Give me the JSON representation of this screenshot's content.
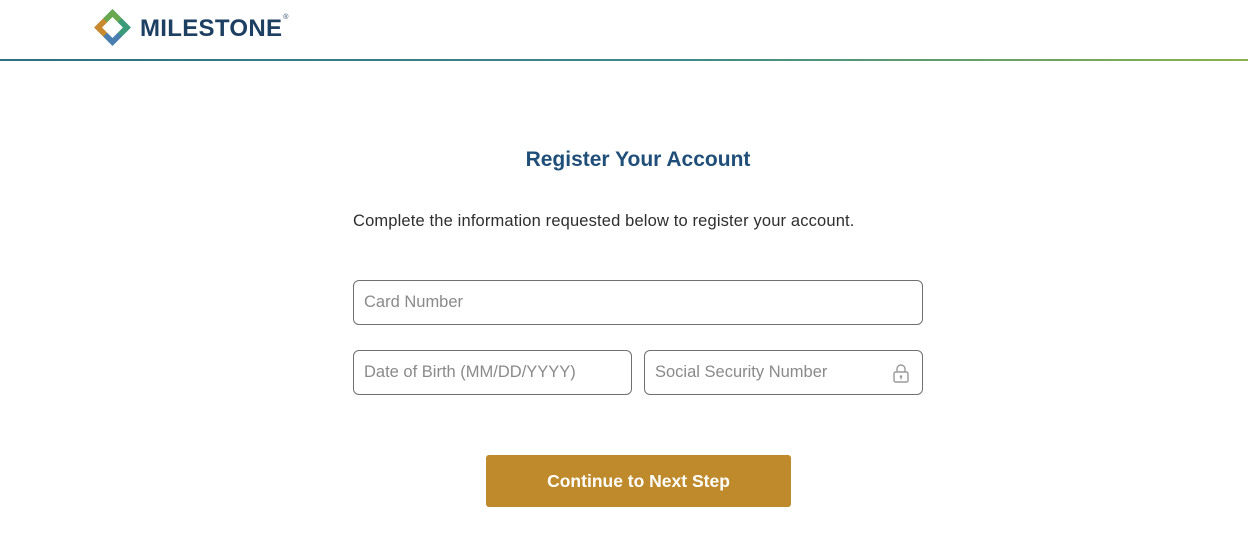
{
  "header": {
    "brand_name": "MILESTONE",
    "brand_mark": "®",
    "logo_icon": "milestone-diamond-logo",
    "accent_gradient": [
      "#2d6f83",
      "#3d8a8a",
      "#8bb24a"
    ]
  },
  "form": {
    "title": "Register Your Account",
    "instructions": "Complete the information requested below to register your account.",
    "card_number": {
      "placeholder": "Card Number",
      "value": ""
    },
    "date_of_birth": {
      "placeholder": "Date of Birth (MM/DD/YYYY)",
      "value": ""
    },
    "ssn": {
      "placeholder": "Social Security Number",
      "value": "",
      "icon": "lock-icon"
    },
    "submit_label": "Continue to Next Step"
  },
  "colors": {
    "title": "#1f4e79",
    "brand_text": "#1d3f62",
    "button": "#bf8a2b",
    "field_border": "#707070"
  }
}
